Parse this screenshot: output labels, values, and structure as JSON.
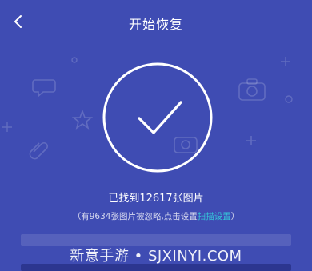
{
  "header": {
    "title": "开始恢复"
  },
  "result": {
    "found_text": "已找到12617张图片",
    "hint_prefix": "（有9634张图片被忽略,点击设置",
    "hint_link": "扫描设置",
    "hint_suffix": "）"
  },
  "watermark": "新意手游 • SJXINYI.COM",
  "colors": {
    "background": "#3f4cb3",
    "accent_link": "#35c5d8",
    "text": "#ffffff"
  }
}
